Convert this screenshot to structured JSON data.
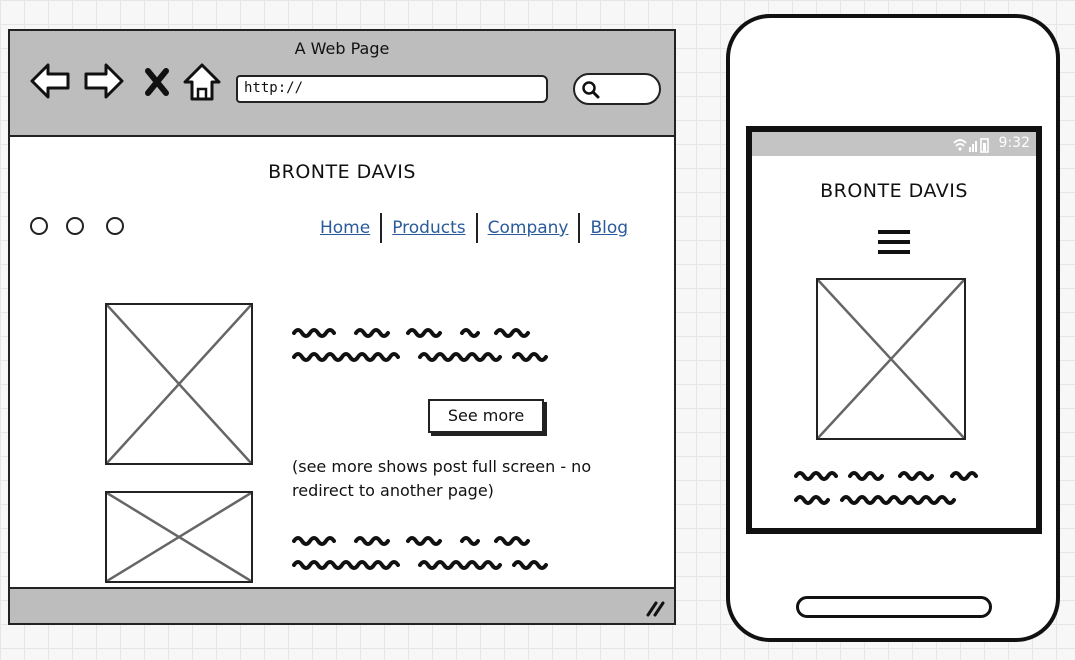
{
  "browser": {
    "title": "A Web Page",
    "url": "http://",
    "nav_icons": [
      "back-arrow-icon",
      "forward-arrow-icon",
      "close-icon",
      "home-icon"
    ]
  },
  "site": {
    "title": "BRONTE DAVIS",
    "nav": [
      "Home",
      "Products",
      "Company",
      "Blog"
    ],
    "see_more_label": "See more",
    "note": "(see more shows post full screen - no redirect to another page)"
  },
  "phone": {
    "status_time": "9:32",
    "title": "BRONTE DAVIS"
  },
  "colors": {
    "chrome_gray": "#bdbdbd",
    "link_blue": "#2a5a9a",
    "outline": "#222222"
  }
}
